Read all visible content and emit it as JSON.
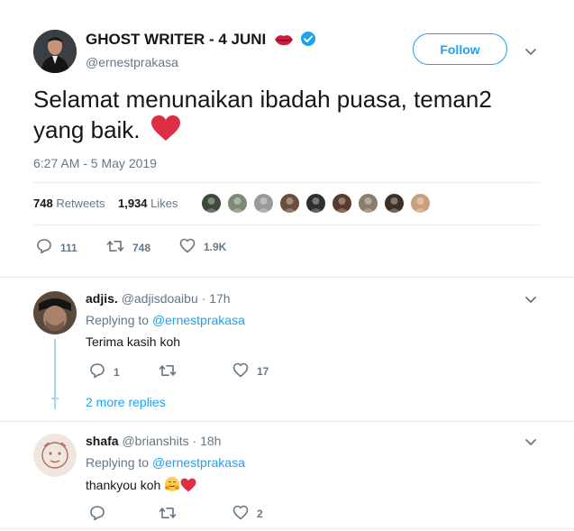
{
  "tweet": {
    "display_name": "GHOST WRITER - 4 JUNI",
    "handle": "@ernestprakasa",
    "follow_label": "Follow",
    "text": "Selamat menunaikan ibadah puasa, teman2 yang baik.",
    "timestamp": "6:27 AM - 5 May 2019",
    "retweets_count": "748",
    "retweets_label": "Retweets",
    "likes_count": "1,934",
    "likes_label": "Likes",
    "liker_avatar_colors": [
      "#3d4a3a",
      "#7d8a73",
      "#9a9a9a",
      "#6b4f3e",
      "#2e2e2e",
      "#5a3a2c",
      "#8a7b6a",
      "#3b3025",
      "#c9a07e"
    ],
    "reply_count": "111",
    "retweet_count": "748",
    "like_count": "1.9K"
  },
  "replies": [
    {
      "name": "adjis.",
      "handle": "@adjisdoaibu",
      "time": "17h",
      "replying_prefix": "Replying to",
      "replying_to": "@ernestprakasa",
      "text": "Terima kasih koh",
      "reply_count": "1",
      "retweet_count": "",
      "like_count": "17",
      "more_replies": "2 more replies"
    },
    {
      "name": "shafa",
      "handle": "@brianshits",
      "time": "18h",
      "replying_prefix": "Replying to",
      "replying_to": "@ernestprakasa",
      "text": "thankyou koh",
      "reply_count": "",
      "retweet_count": "",
      "like_count": "2"
    }
  ],
  "colors": {
    "accent": "#1da1f2",
    "like_heart": "#e0245e",
    "verified": "#1da1f2",
    "muted": "#657786"
  }
}
